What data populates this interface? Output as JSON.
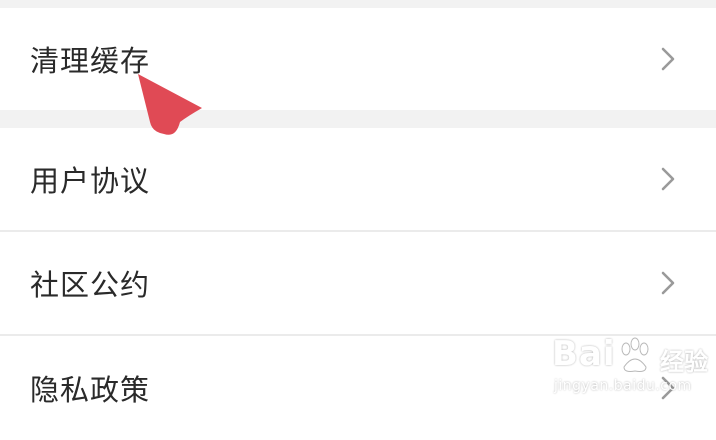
{
  "settings": {
    "items": [
      {
        "label": "清理缓存",
        "icon": "chevron-right-icon"
      },
      {
        "label": "用户协议",
        "icon": "chevron-right-icon"
      },
      {
        "label": "社区公约",
        "icon": "chevron-right-icon"
      },
      {
        "label": "隐私政策",
        "icon": "chevron-right-icon"
      }
    ]
  },
  "overlay": {
    "cursor_icon": "red-arrow-pointer-icon",
    "cursor_color": "#e04a55"
  },
  "watermark": {
    "brand": "Bai",
    "suffix": "经验",
    "url": "jingyan.baidu.com",
    "icon": "paw-icon"
  },
  "colors": {
    "background": "#f2f2f2",
    "row_background": "#ffffff",
    "text": "#2a2a2a",
    "chevron": "#9a9a9a"
  }
}
